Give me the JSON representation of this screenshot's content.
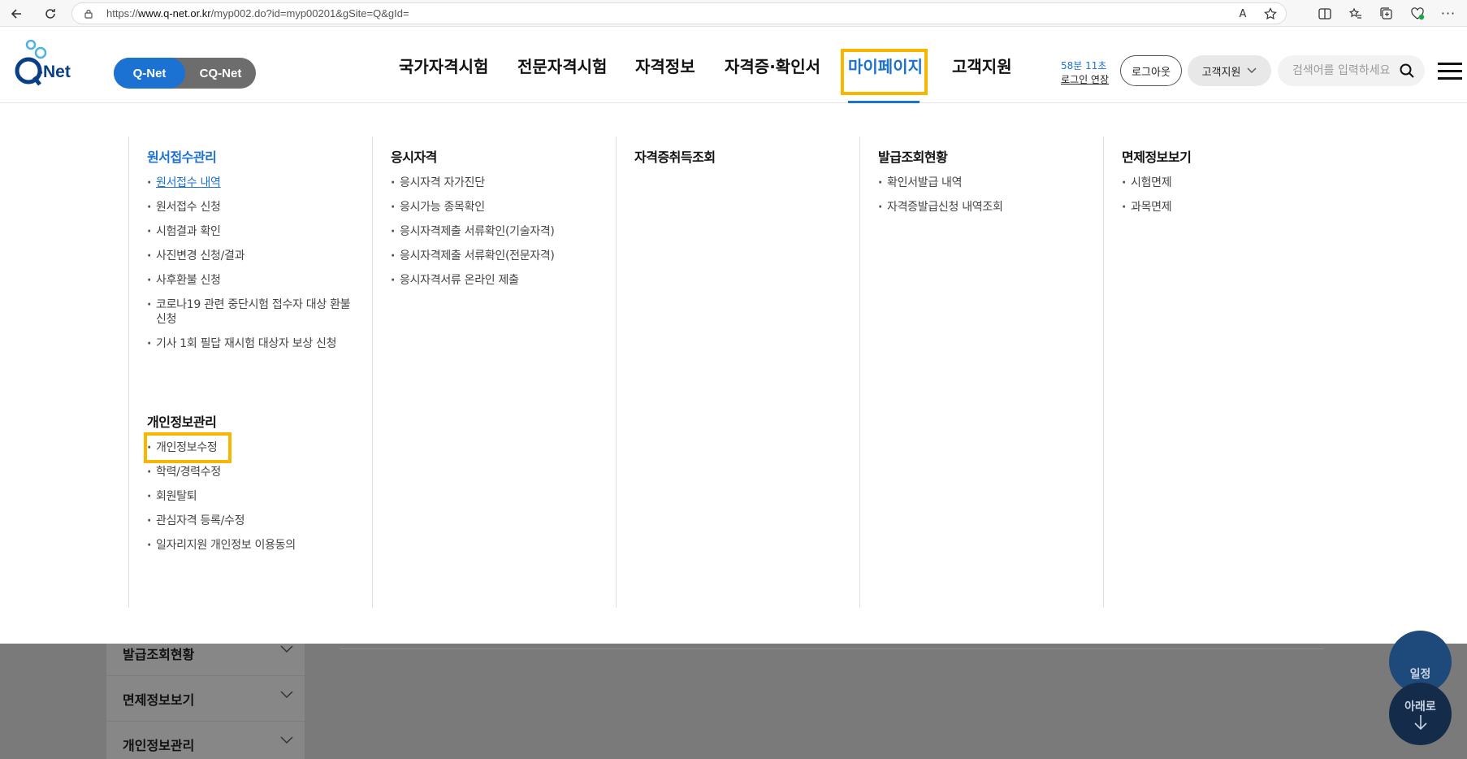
{
  "browser": {
    "url_prefix": "https://",
    "url_host": "www.q-net.or.kr",
    "url_path": "/myp002.do?id=myp00201&gSite=Q&gId="
  },
  "header": {
    "logo_text": "-Net",
    "toggle": {
      "active": "Q-Net",
      "inactive": "CQ-Net"
    },
    "gnb": [
      "국가자격시험",
      "전문자격시험",
      "자격정보",
      "자격증·확인서",
      "마이페이지",
      "고객지원"
    ],
    "timer": "58분 11초",
    "extend_label": "로그인 연장",
    "logout_label": "로그아웃",
    "support_label": "고객지원",
    "search_placeholder": "검색어를 입력하세요"
  },
  "mega_menu": {
    "columns": [
      {
        "title": "원서접수관리",
        "items": [
          "원서접수 내역",
          "원서접수 신청",
          "시험결과 확인",
          "사진변경 신청/결과",
          "사후환불 신청",
          "코로나19 관련 중단시험 접수자 대상 환불 신청",
          "기사 1회 필답 재시험 대상자 보상 신청"
        ],
        "subtitle": "개인정보관리",
        "sub_items": [
          "개인정보수정",
          "학력/경력수정",
          "회원탈퇴",
          "관심자격 등록/수정",
          "일자리지원 개인정보 이용동의"
        ]
      },
      {
        "title": "응시자격",
        "items": [
          "응시자격 자가진단",
          "응시가능 종목확인",
          "응시자격제출 서류확인(기술자격)",
          "응시자격제출 서류확인(전문자격)",
          "응시자격서류 온라인 제출"
        ]
      },
      {
        "title": "자격증취득조회",
        "items": []
      },
      {
        "title": "발급조회현황",
        "items": [
          "확인서발급 내역",
          "자격증발급신청 내역조회"
        ]
      },
      {
        "title": "면제정보보기",
        "items": [
          "시험면제",
          "과목면제"
        ]
      }
    ]
  },
  "background_page": {
    "side_items": [
      "발급조회현황",
      "면제정보보기",
      "개인정보관리"
    ],
    "float_schedule": "일정",
    "float_down": "아래로"
  },
  "colors": {
    "brand_blue": "#1b72d2",
    "highlight": "#f8b600"
  }
}
